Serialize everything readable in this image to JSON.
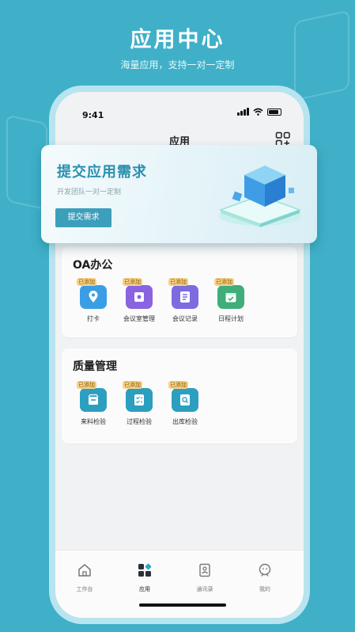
{
  "hero": {
    "title": "应用中心",
    "subtitle": "海量应用，支持一对一定制"
  },
  "status": {
    "time": "9:41"
  },
  "nav": {
    "title": "应用"
  },
  "banner": {
    "title": "提交应用需求",
    "subtitle": "开发团队一对一定制",
    "button": "提交需求"
  },
  "sections": [
    {
      "title": "OA办公",
      "items": [
        {
          "label": "打卡",
          "badge": "已添加",
          "color": "#3a9ee6",
          "icon": "location-pin-icon"
        },
        {
          "label": "会议室管理",
          "badge": "已添加",
          "color": "#8a63e0",
          "icon": "meeting-room-icon"
        },
        {
          "label": "会议记录",
          "badge": "已添加",
          "color": "#7d6be0",
          "icon": "notes-icon"
        },
        {
          "label": "日程计划",
          "badge": "已添加",
          "color": "#3fae7a",
          "icon": "calendar-check-icon"
        }
      ]
    },
    {
      "title": "质量管理",
      "items": [
        {
          "label": "来料检验",
          "badge": "已添加",
          "color": "#2c9fc0",
          "icon": "incoming-box-icon"
        },
        {
          "label": "过程检验",
          "badge": "已添加",
          "color": "#2c9fc0",
          "icon": "checklist-icon"
        },
        {
          "label": "出库检验",
          "badge": "已添加",
          "color": "#2c9fc0",
          "icon": "search-doc-icon"
        }
      ]
    }
  ],
  "tabbar": {
    "items": [
      {
        "label": "工作台",
        "icon": "home-icon"
      },
      {
        "label": "应用",
        "icon": "apps-grid-icon",
        "active": true
      },
      {
        "label": "通讯录",
        "icon": "contacts-icon"
      },
      {
        "label": "我的",
        "icon": "profile-icon"
      }
    ]
  },
  "colors": {
    "background": "#3fb0c8",
    "accent": "#2a8fb0",
    "badge": "#f5d28a"
  }
}
